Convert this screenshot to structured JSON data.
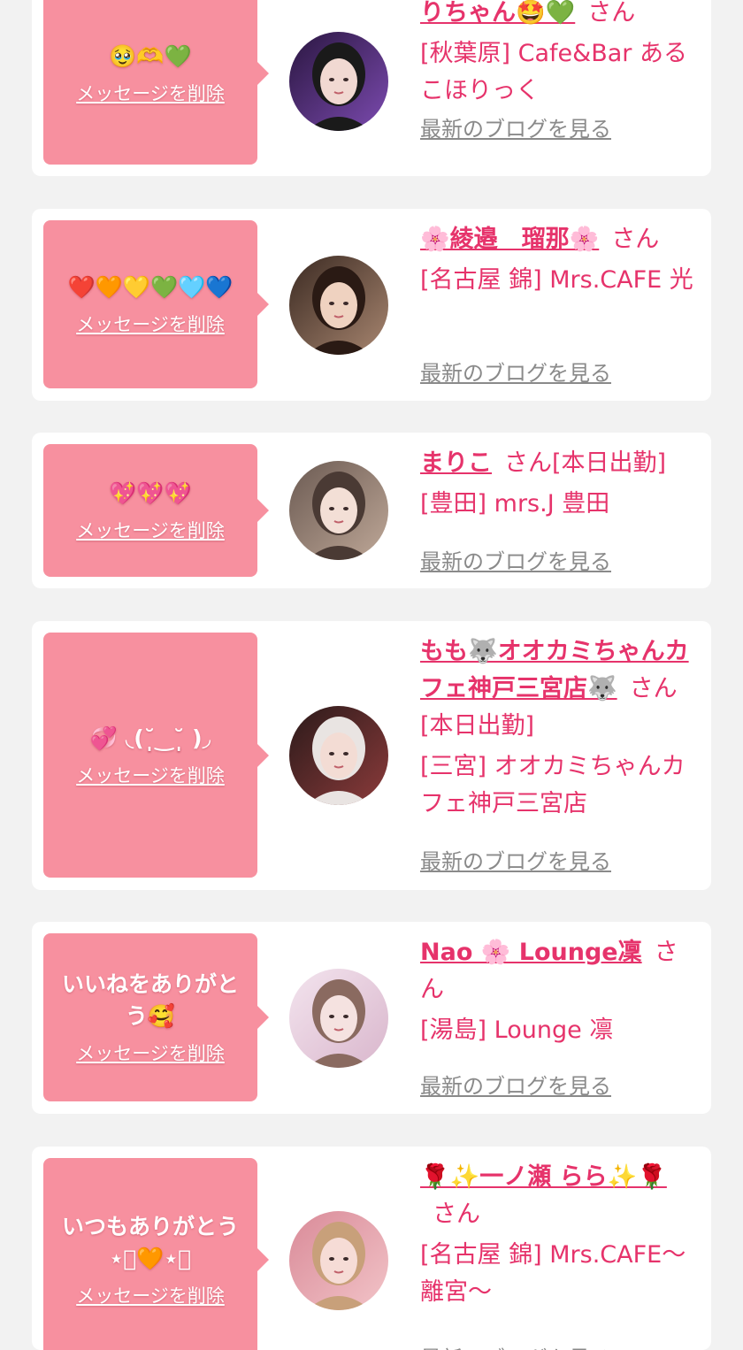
{
  "common": {
    "delete_label": "メッセージを削除",
    "blog_label": "最新のブログを見る",
    "san": "さん"
  },
  "colors": {
    "page_bg": "#f2f2f2",
    "card_bg": "#ffffff",
    "bubble": "#f7909f",
    "accent": "#e6336b",
    "link_gray": "#8a8a8a"
  },
  "cards": [
    {
      "message": "🥹🫶💚",
      "name": "りちゃん🤩💚",
      "status": "",
      "shop": "[秋葉原] Cafe&Bar あるこほりっく",
      "avatar_icon": "avatar-photo"
    },
    {
      "message": "❤️🧡💛💚🩵💙",
      "name": "🌸綾邉　瑠那🌸",
      "status": "",
      "shop": "[名古屋 錦] Mrs.CAFE 光",
      "avatar_icon": "avatar-photo"
    },
    {
      "message": "💖💖💖",
      "name": "まりこ",
      "status": "[本日出勤]",
      "shop": "[豊田] mrs.J 豊田",
      "avatar_icon": "avatar-photo"
    },
    {
      "message": "💞 ◟(˘̩̩̩‿˘̩̩̩ )◞",
      "name": "もも🐺オオカミちゃんカフェ神戸三宮店🐺",
      "status": "[本日出勤]",
      "shop": "[三宮] オオカミちゃんカフェ神戸三宮店",
      "avatar_icon": "avatar-photo"
    },
    {
      "message": "いいねをありがとう🥰",
      "name": "Nao 🌸 Lounge凜",
      "status": "",
      "shop": "[湯島] Lounge 凛",
      "avatar_icon": "avatar-photo"
    },
    {
      "message": "いつもありがとう ⋆͛🧡⋆͛",
      "name": "🌹✨一ノ瀬 らら✨🌹",
      "status": "",
      "shop": "[名古屋 錦] Mrs.CAFE〜離宮〜",
      "avatar_icon": "avatar-photo"
    }
  ]
}
